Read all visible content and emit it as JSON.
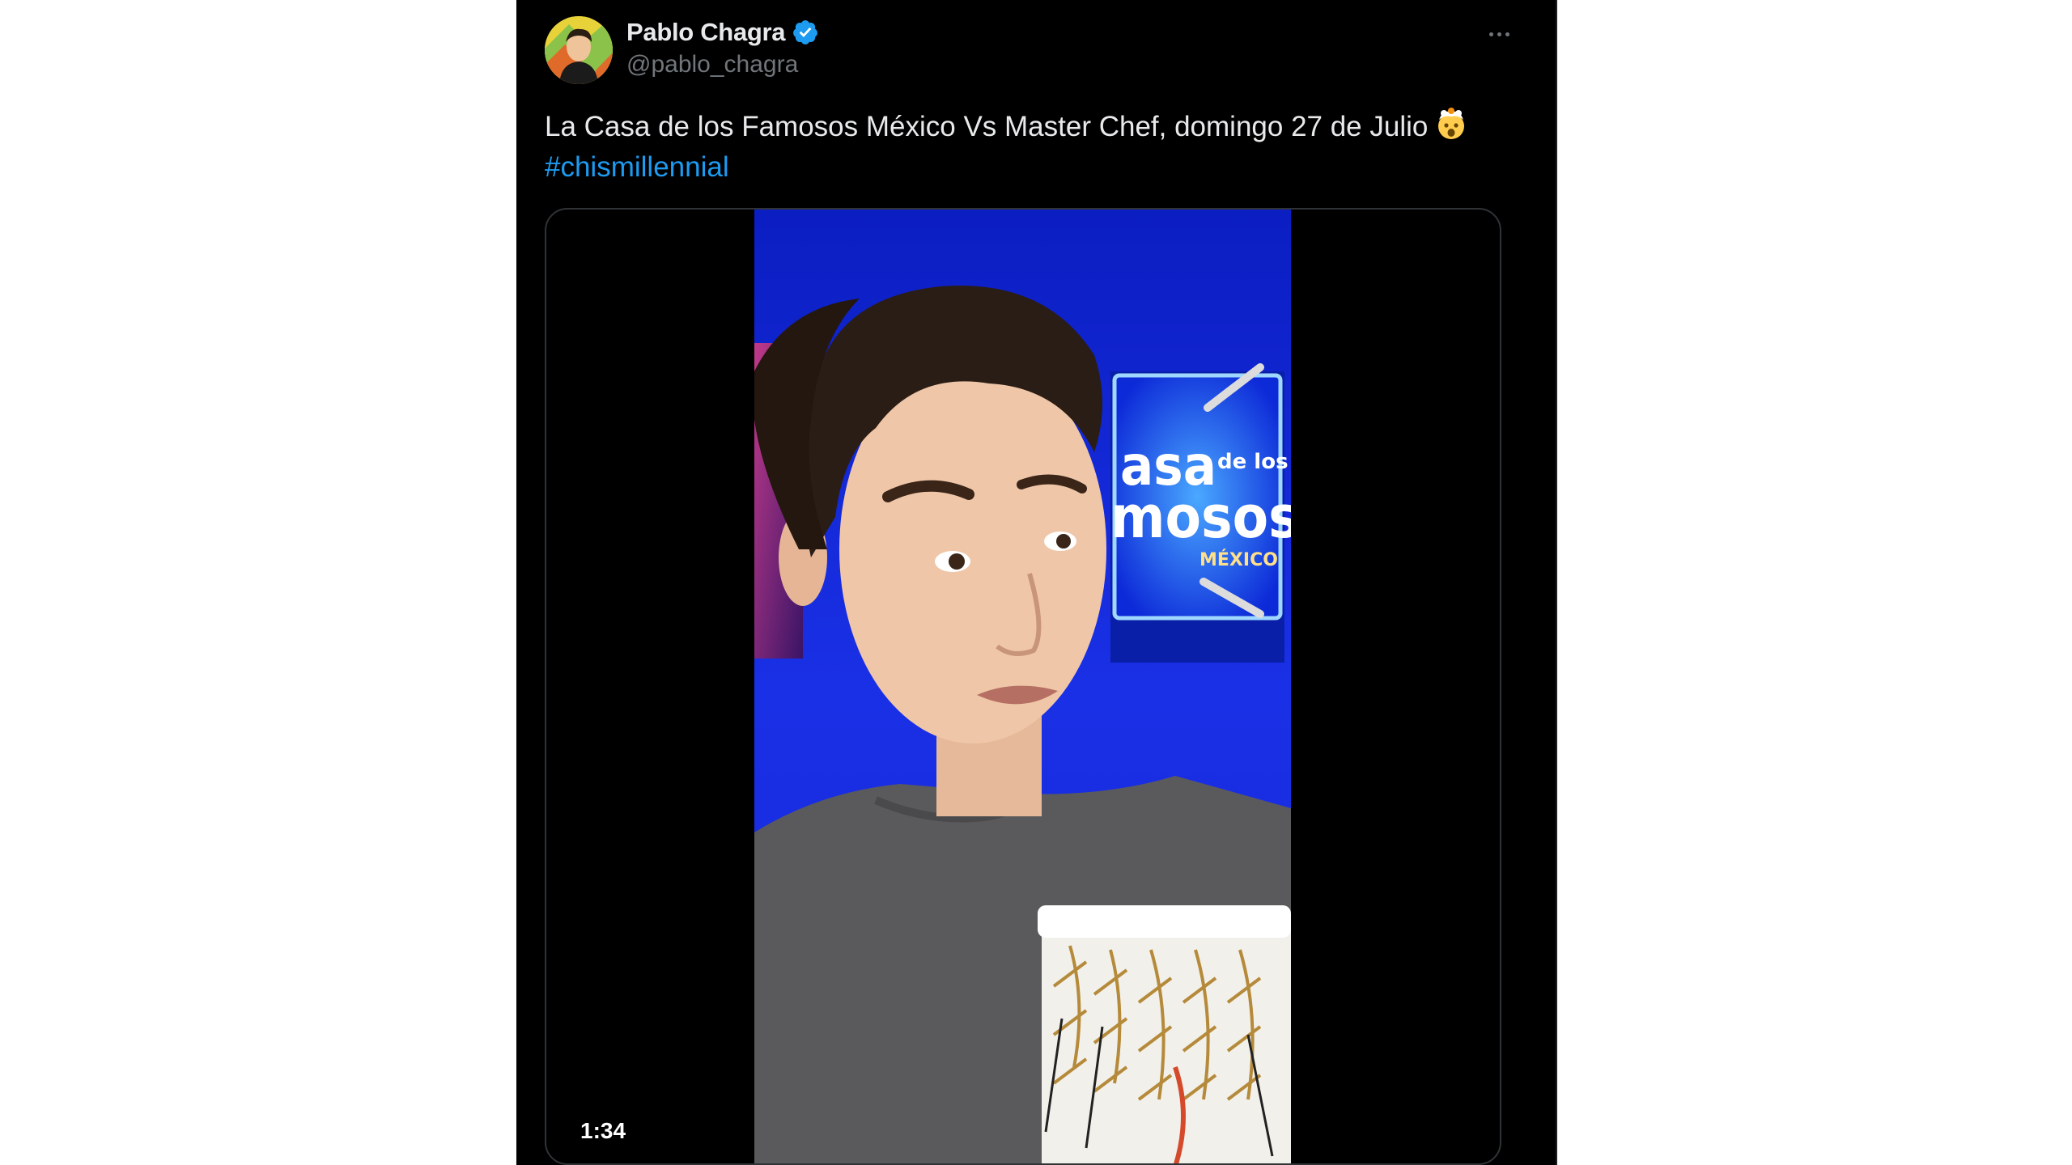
{
  "tweet": {
    "display_name": "Pablo Chagra",
    "handle": "@pablo_chagra",
    "text": "La Casa de los Famosos México Vs Master Chef, domingo 27 de Julio",
    "hashtag": "#chismillennial",
    "video_duration": "1:34"
  },
  "video_frame": {
    "sign_line1": "asa",
    "sign_line1_small": "de los",
    "sign_line2": "mosos",
    "sign_line3": "MÉXICO"
  },
  "colors": {
    "background": "#000000",
    "text": "#e7e9ea",
    "secondary_text": "#71767b",
    "link": "#1d9bf0",
    "verified_badge": "#1d9bf0",
    "border": "#2f3336"
  },
  "icons": {
    "verified": "verified-badge-icon",
    "more": "more-options-icon",
    "emoji": "exploding-head-emoji"
  }
}
